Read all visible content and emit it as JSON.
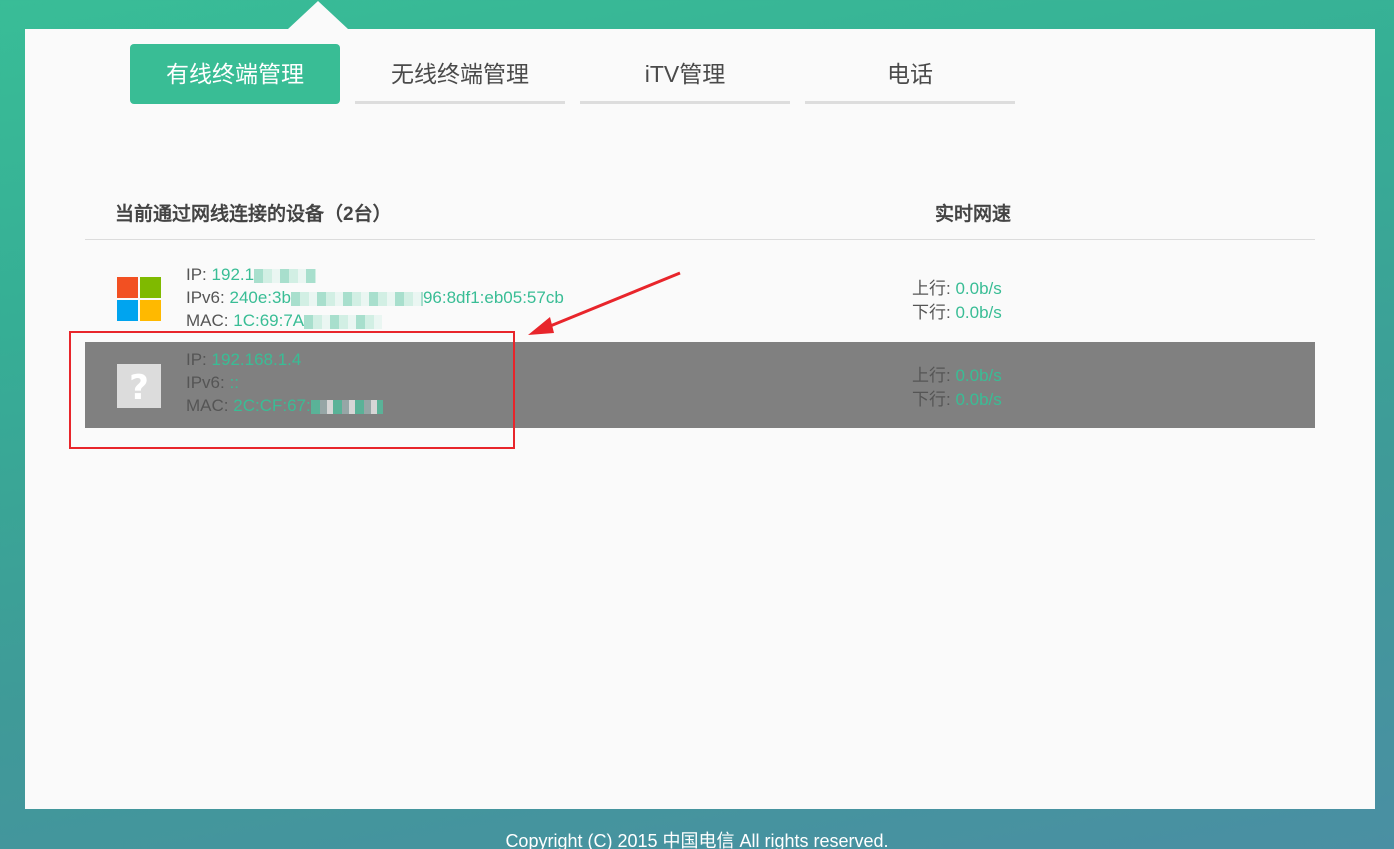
{
  "tabs": [
    {
      "label": "有线终端管理",
      "active": true
    },
    {
      "label": "无线终端管理",
      "active": false
    },
    {
      "label": "iTV管理",
      "active": false
    },
    {
      "label": "电话",
      "active": false
    }
  ],
  "list": {
    "header_devices": "当前通过网线连接的设备（2台）",
    "header_speed": "实时网速"
  },
  "devices": [
    {
      "icon": "windows-logo-icon",
      "ip_label": "IP:",
      "ip": "192.1",
      "ipv6_label": "IPv6:",
      "ipv6_prefix": "240e:3b",
      "ipv6_suffix": "96:8df1:eb05:57cb",
      "mac_label": "MAC:",
      "mac": "1C:69:7A",
      "up_label": "上行:",
      "up": "0.0b/s",
      "down_label": "下行:",
      "down": "0.0b/s"
    },
    {
      "icon": "unknown-device-icon",
      "ip_label": "IP:",
      "ip": "192.168.1.4",
      "ipv6_label": "IPv6:",
      "ipv6": "::",
      "mac_label": "MAC:",
      "mac": "2C:CF:67:",
      "up_label": "上行:",
      "up": "0.0b/s",
      "down_label": "下行:",
      "down": "0.0b/s"
    }
  ],
  "footer": {
    "copyright": "Copyright (C) 2015 中国电信 All rights reserved."
  },
  "colors": {
    "accent": "#39bd95",
    "highlight_row": "#808080",
    "annotation": "#e8252b"
  }
}
